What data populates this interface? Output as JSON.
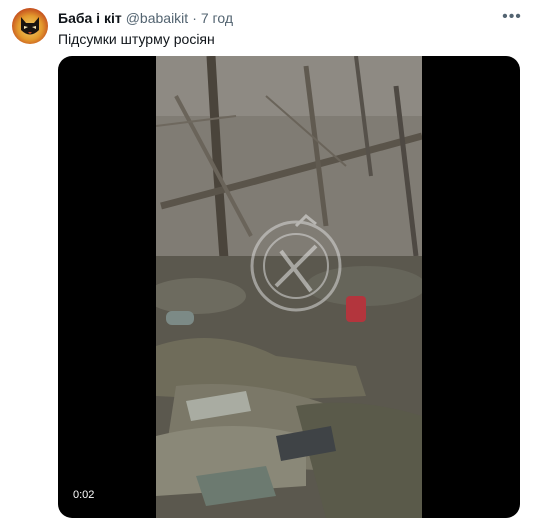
{
  "tweet": {
    "author_name": "Баба і кіт",
    "author_handle": "@babaikit",
    "separator": "·",
    "time": "7 год",
    "text": "Підсумки штурму росіян",
    "more_icon": "more-dots-icon",
    "media": {
      "type": "video",
      "timestamp": "0:02"
    }
  }
}
